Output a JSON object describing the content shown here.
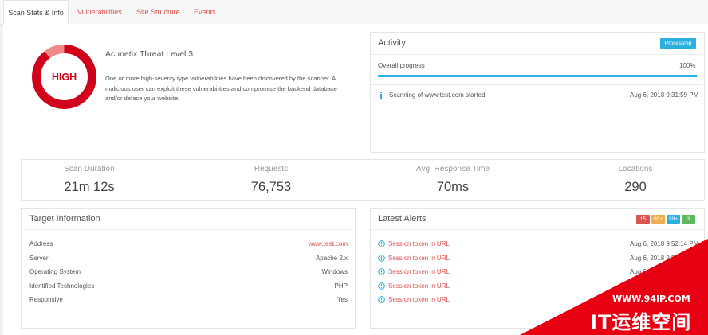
{
  "tabs": [
    "Scan Stats & Info",
    "Vulnerabilities",
    "Site Structure",
    "Events"
  ],
  "threat": {
    "level_badge": "HIGH",
    "title": "Acunetix Threat Level 3",
    "description": "One or more high-severity type vulnerabilities have been discovered by the scanner. A malicious user can exploit these vulnerabilities and compromise the backend database and/or deface your website.",
    "color": "#d0021b"
  },
  "activity": {
    "title": "Activity",
    "status": "Processing",
    "progress_label": "Overall progress",
    "progress_value": "100%",
    "progress_fraction": 1.0,
    "event_text": "Scanning of www.test.com started",
    "event_time": "Aug 6, 2018 9:31:59 PM",
    "event_icon": "info-icon"
  },
  "stats": [
    {
      "label": "Scan Duration",
      "value": "21m 12s"
    },
    {
      "label": "Requests",
      "value": "76,753"
    },
    {
      "label": "Avg. Response Time",
      "value": "70ms"
    },
    {
      "label": "Locations",
      "value": "290"
    }
  ],
  "target": {
    "title": "Target Information",
    "rows": [
      {
        "label": "Address",
        "value": "www.test.com"
      },
      {
        "label": "Server",
        "value": "Apache 2.x"
      },
      {
        "label": "Operating System",
        "value": "Windows"
      },
      {
        "label": "Identified Technologies",
        "value": "PHP"
      },
      {
        "label": "Responsive",
        "value": "Yes"
      }
    ]
  },
  "alerts": {
    "title": "Latest Alerts",
    "counts": [
      {
        "value": "15",
        "color": "#d9534f"
      },
      {
        "value": "99+",
        "color": "#f0ad4e"
      },
      {
        "value": "99+",
        "color": "#2cb0e0"
      },
      {
        "value": "3",
        "color": "#5cb85c"
      }
    ],
    "items": [
      {
        "text": "Session token in URL",
        "time": "Aug 6, 2018 9:52:14 PM"
      },
      {
        "text": "Session token in URL",
        "time": "Aug 6, 2018 9:5"
      },
      {
        "text": "Session token in URL",
        "time": "Aug 6"
      },
      {
        "text": "Session token in URL",
        "time": ""
      },
      {
        "text": "Session token in URL",
        "time": ""
      }
    ]
  },
  "watermark": {
    "url": "WWW.94IP.COM",
    "title": "IT运维空间",
    "color": "#e60012"
  }
}
